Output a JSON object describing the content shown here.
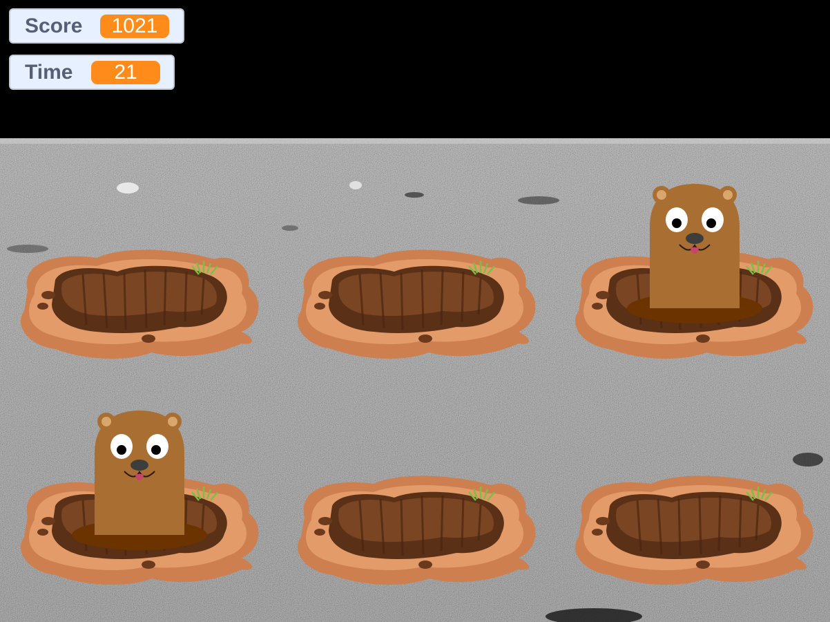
{
  "hud": {
    "score_label": "Score",
    "score_value": "1021",
    "time_label": "Time",
    "time_value": "21"
  },
  "holes": [
    {
      "id": "top-left",
      "mole_visible": false
    },
    {
      "id": "top-center",
      "mole_visible": false
    },
    {
      "id": "top-right",
      "mole_visible": true
    },
    {
      "id": "bottom-left",
      "mole_visible": true
    },
    {
      "id": "bottom-center",
      "mole_visible": false
    },
    {
      "id": "bottom-right",
      "mole_visible": false
    }
  ],
  "colors": {
    "sky": "#000000",
    "ground": "#8c8c8c",
    "dirt": "#cd7f4f",
    "mole": "#a86e32",
    "monitor_bg": "#e6f0ff",
    "monitor_value": "#ff8c1a"
  }
}
